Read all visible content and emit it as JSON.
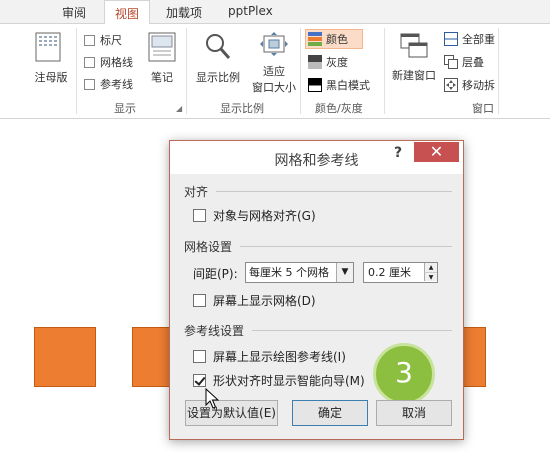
{
  "ribbon": {
    "tabs": [
      "审阅",
      "视图",
      "加载项",
      "pptPlex"
    ],
    "active_tab": "视图",
    "accent": "#b7472a",
    "master_view_label": "注母版",
    "show_group": {
      "ruler": "标尺",
      "gridlines": "网格线",
      "guides": "参考线",
      "notes": "笔记",
      "label": "显示"
    },
    "zoom_group": {
      "zoom": "显示比例",
      "fit_line1": "适应",
      "fit_line2": "窗口大小",
      "label": "显示比例"
    },
    "color_group": {
      "color": "颜色",
      "grayscale": "灰度",
      "bw": "黑白模式",
      "label": "颜色/灰度"
    },
    "window_group": {
      "new_window": "新建窗口",
      "arrange_all": "全部重",
      "cascade": "层叠",
      "move_split": "移动拆",
      "label": "窗口"
    }
  },
  "dialog": {
    "title": "网格和参考线",
    "help": "?",
    "close": "✕",
    "align_section": "对齐",
    "snap_to_grid": "对象与网格对齐(G)",
    "snap_checked": false,
    "grid_section": "网格设置",
    "spacing_label": "间距(P):",
    "spacing_select": "每厘米 5 个网格",
    "spacing_value": "0.2 厘米",
    "show_grid": "屏幕上显示网格(D)",
    "show_grid_checked": false,
    "guides_section": "参考线设置",
    "show_drawing_guides": "屏幕上显示绘图参考线(I)",
    "drawing_guides_checked": false,
    "smart_guides": "形状对齐时显示智能向导(M)",
    "smart_guides_checked": true,
    "set_default": "设置为默认值(E)",
    "ok": "确定",
    "cancel": "取消"
  },
  "step_badge": "3",
  "colors": {
    "shape_fill": "#ed7d31",
    "badge": "#8cbf3f",
    "close_button": "#c75050"
  }
}
